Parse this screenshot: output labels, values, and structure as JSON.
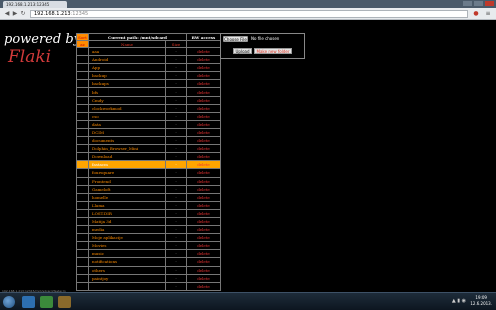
{
  "browser": {
    "tab_title": "192.168.1.213:12345",
    "url_host": "192.168.1.213",
    "url_port": ":12345",
    "back_icon": "back-arrow-icon",
    "forward_icon": "forward-arrow-icon",
    "reload_icon": "reload-icon"
  },
  "brand": {
    "powered": "powered by",
    "name": "Flaki"
  },
  "table": {
    "current_path": "Current path: /mnt/sdcard",
    "rw_access": "RW access",
    "sort_label": "Sort",
    "sort_dir": "az",
    "name_header": "Name",
    "size_header": "Size",
    "delete_label": "delete",
    "size_placeholder": "-",
    "rows": [
      {
        "name": "aaa"
      },
      {
        "name": "Android"
      },
      {
        "name": "App"
      },
      {
        "name": "backup"
      },
      {
        "name": "backups"
      },
      {
        "name": "bfs"
      },
      {
        "name": "Cmdy"
      },
      {
        "name": "clockworkmod"
      },
      {
        "name": "cso"
      },
      {
        "name": "data"
      },
      {
        "name": "DCIM"
      },
      {
        "name": "documents"
      },
      {
        "name": "Dolphin_Browser_Mini"
      },
      {
        "name": "Download"
      },
      {
        "name": "fastacm"
      },
      {
        "name": "foursquare"
      },
      {
        "name": "Frontend"
      },
      {
        "name": "Gameloft"
      },
      {
        "name": "homelle"
      },
      {
        "name": "Llama"
      },
      {
        "name": "LOST.DIR"
      },
      {
        "name": "Matija 3d"
      },
      {
        "name": "media"
      },
      {
        "name": "Moje aplikacije"
      },
      {
        "name": "Movies"
      },
      {
        "name": "music"
      },
      {
        "name": "notifications"
      },
      {
        "name": "others"
      },
      {
        "name": "paintjoy"
      },
      {
        "name": ""
      }
    ],
    "highlighted_index": 14
  },
  "upload": {
    "choose_label": "Choose File",
    "no_file": "No file chosen",
    "upload_label": "Upload",
    "mkdir_label": "Make new folder"
  },
  "status": {
    "text": "192.168.1.213:12345/mnt/sdcard/fastacm"
  },
  "taskbar": {
    "time": "19:09",
    "date": "12.6.2013."
  },
  "colors": {
    "accent": "#ff8c00",
    "delete": "#e33333",
    "brand": "#d23a3a",
    "background": "#000000"
  }
}
